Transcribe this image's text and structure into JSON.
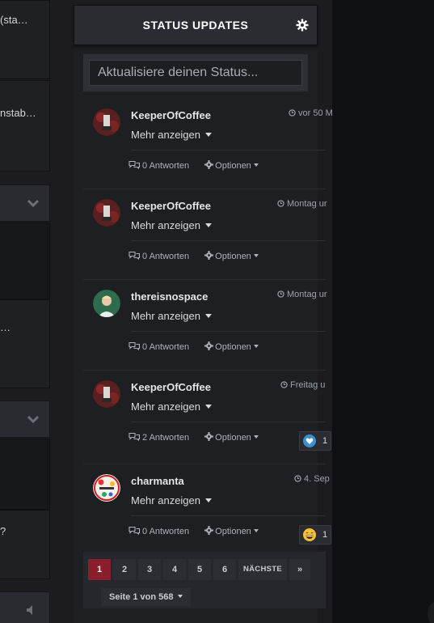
{
  "left_column": {
    "texts": [
      "(sta…",
      "nstab…",
      "…",
      "?"
    ]
  },
  "widget": {
    "title": "STATUS UPDATES",
    "status_placeholder": "Aktualisiere deinen Status...",
    "more_label": "Mehr anzeigen",
    "options_label": "Optionen",
    "posts": [
      {
        "user": "KeeperOfCoffee",
        "time": "vor 50 M",
        "replies": "0 Antworten",
        "reaction": null
      },
      {
        "user": "KeeperOfCoffee",
        "time": "Montag ur",
        "replies": "0 Antworten",
        "reaction": null
      },
      {
        "user": "thereisnospace",
        "time": "Montag ur",
        "replies": "0 Antworten",
        "reaction": null
      },
      {
        "user": "KeeperOfCoffee",
        "time": "Freitag u",
        "replies": "2 Antworten",
        "reaction": {
          "icon": "heart-reaction-icon",
          "count": "1"
        }
      },
      {
        "user": "charmanta",
        "time": "4. Sep",
        "replies": "0 Antworten",
        "reaction": {
          "icon": "grin-reaction-icon",
          "count": "1"
        }
      }
    ]
  },
  "pagination": {
    "pages": [
      "1",
      "2",
      "3",
      "4",
      "5",
      "6"
    ],
    "next_label": "NÄCHSTE",
    "last_label": "»",
    "page_of": "Seite 1 von 568"
  },
  "colors": {
    "active_page": "#8b1e2b",
    "background": "#1c1c20",
    "panel": "#1e1f23"
  }
}
